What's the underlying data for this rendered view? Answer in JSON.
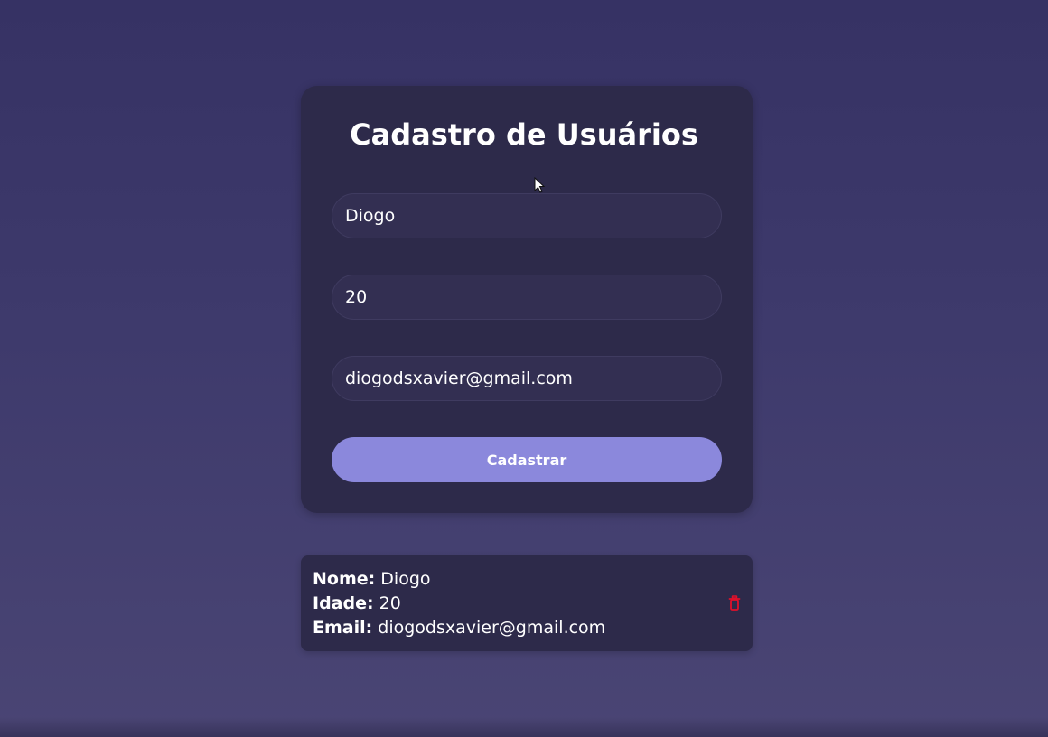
{
  "form": {
    "title": "Cadastro de Usuários",
    "name_value": "Diogo",
    "age_value": "20",
    "email_value": "diogodsxavier@gmail.com",
    "submit_label": "Cadastrar"
  },
  "user_card": {
    "name_label": "Nome:",
    "name_value": "Diogo",
    "age_label": "Idade:",
    "age_value": "20",
    "email_label": "Email:",
    "email_value": "diogodsxavier@gmail.com",
    "delete_icon": "trash-icon"
  },
  "colors": {
    "background": "#3a366a",
    "card": "#2d2a4a",
    "accent": "#8b88dc",
    "delete": "#e0102a"
  }
}
